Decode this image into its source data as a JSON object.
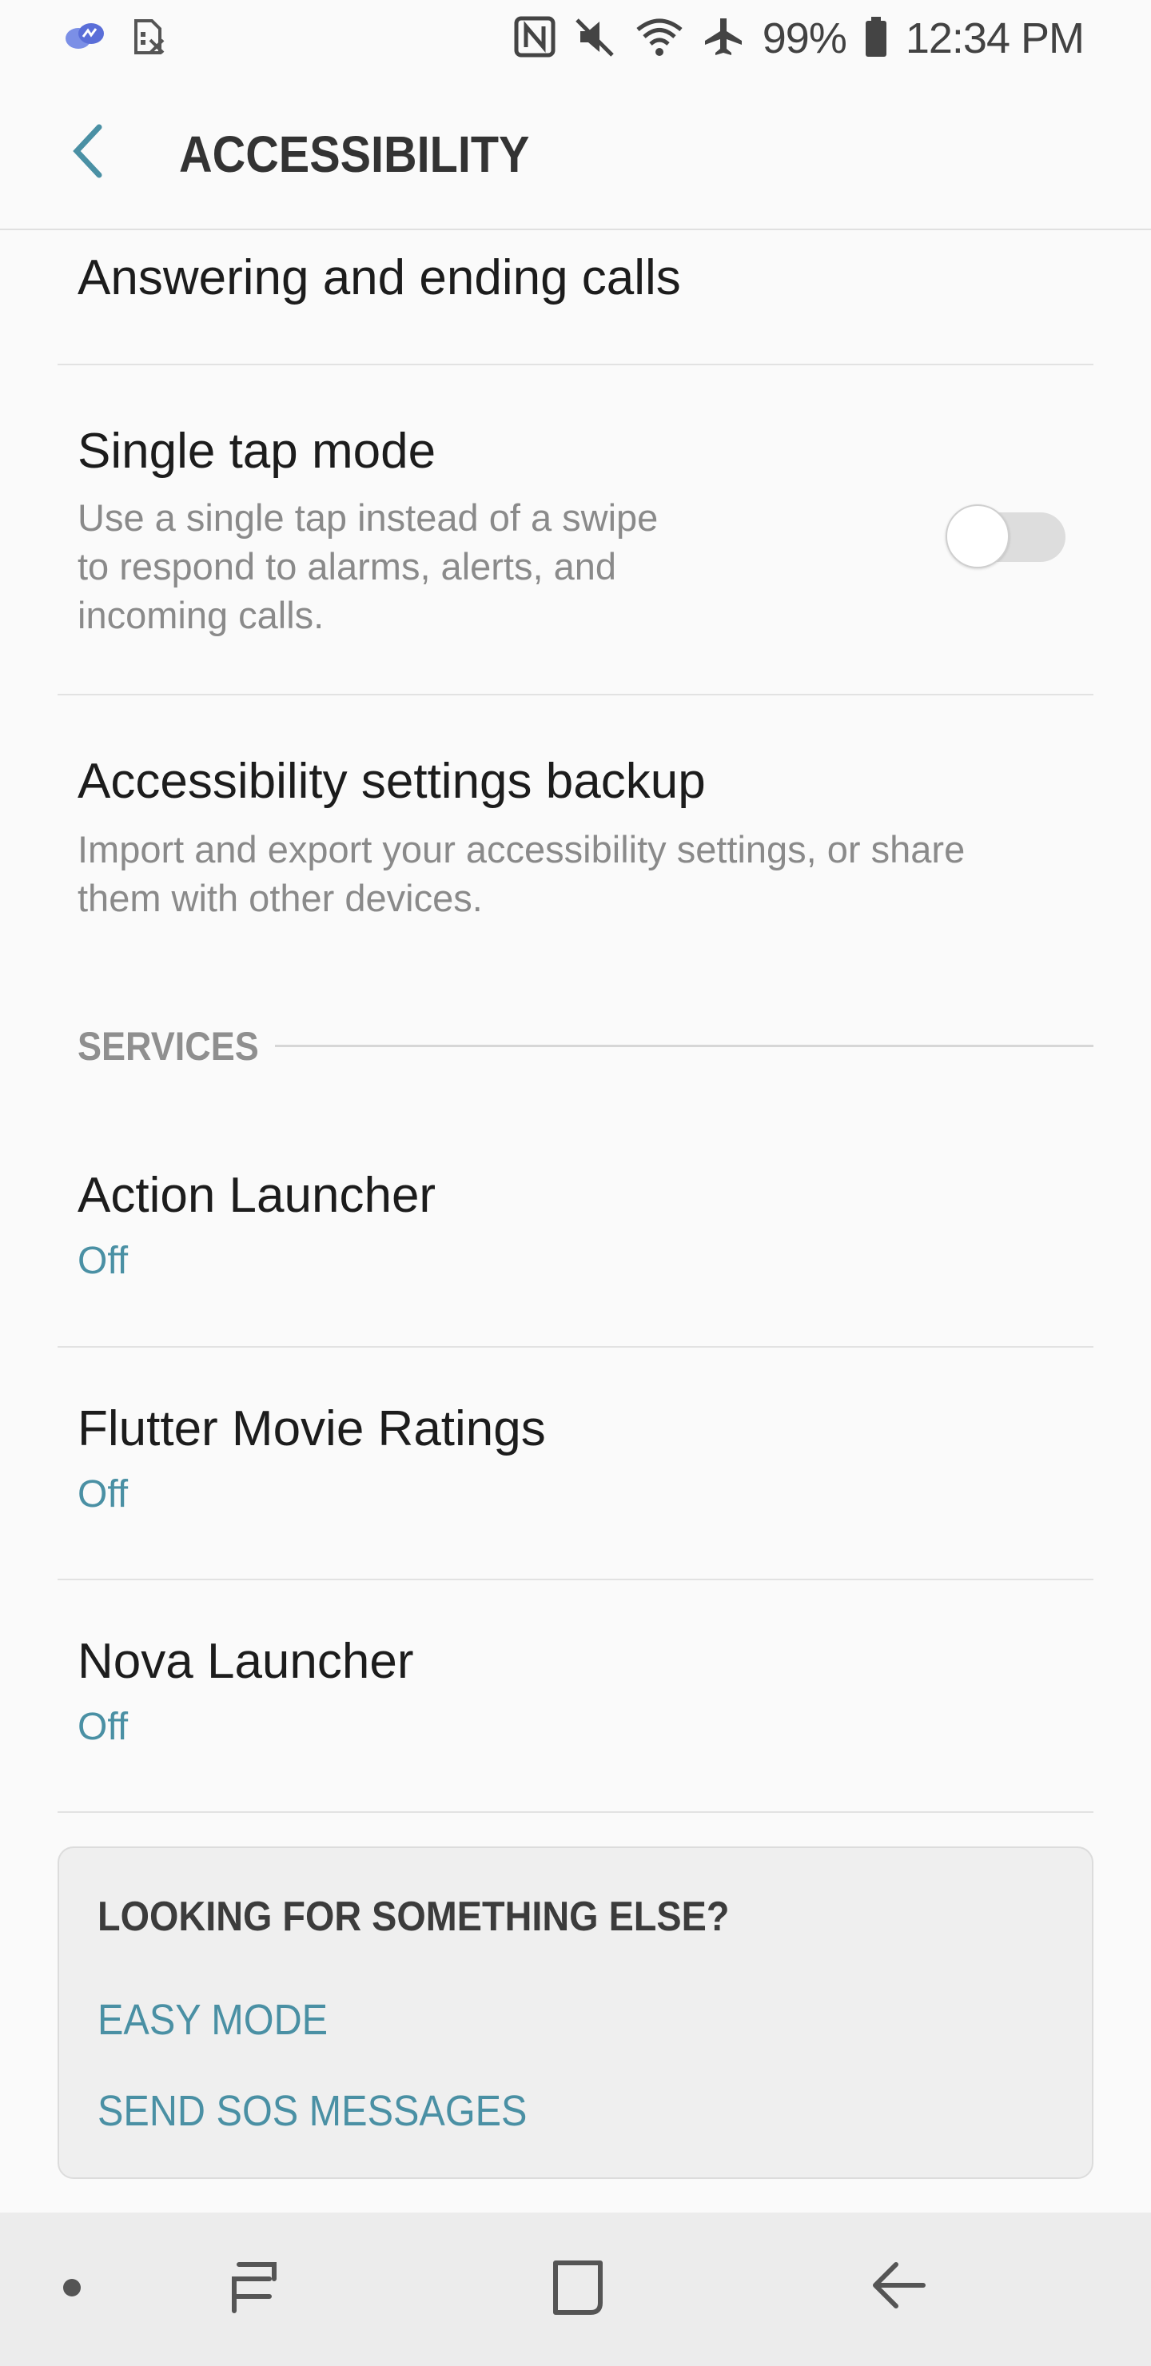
{
  "status_bar": {
    "battery_percent": "99%",
    "time": "12:34 PM",
    "icons": [
      "messenger-icon",
      "sim-blocked-icon",
      "nfc-icon",
      "mute-icon",
      "wifi-icon",
      "airplane-icon",
      "battery-icon"
    ]
  },
  "header": {
    "title": "ACCESSIBILITY",
    "back_icon": "back-chevron-icon"
  },
  "items": {
    "answering": {
      "title": "Answering and ending calls"
    },
    "single_tap": {
      "title": "Single tap mode",
      "desc_line1": "Use a single tap instead of a swipe",
      "desc_line2": "to respond to alarms, alerts, and",
      "desc_line3": "incoming calls.",
      "toggle_on": false
    },
    "backup": {
      "title": "Accessibility settings backup",
      "desc_line1": "Import and export your accessibility settings, or share",
      "desc_line2": "them with other devices."
    }
  },
  "services": {
    "header": "SERVICES",
    "items": [
      {
        "title": "Action Launcher",
        "status": "Off"
      },
      {
        "title": "Flutter Movie Ratings",
        "status": "Off"
      },
      {
        "title": "Nova Launcher",
        "status": "Off"
      }
    ]
  },
  "suggestions": {
    "title": "LOOKING FOR SOMETHING ELSE?",
    "links": [
      "EASY MODE",
      "SEND SOS MESSAGES"
    ]
  },
  "colors": {
    "accent": "#4a90a4",
    "background": "#fafafa",
    "secondary_text": "#8a8a8a"
  },
  "nav_bar": {
    "icons": [
      "dot-icon",
      "recents-icon",
      "home-icon",
      "back-icon"
    ]
  }
}
